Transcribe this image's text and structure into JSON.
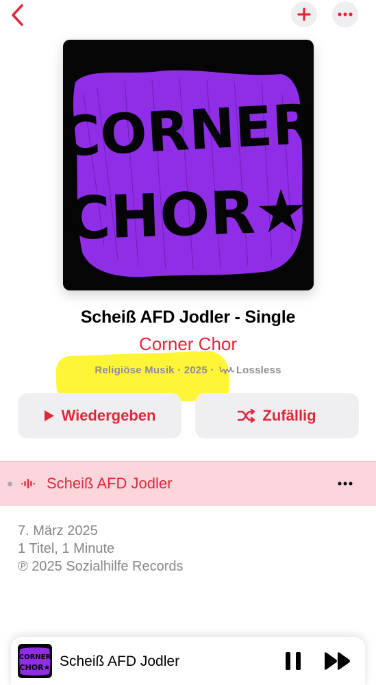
{
  "nav": {
    "back_icon": "chevron-left-icon",
    "add_icon": "plus-icon",
    "more_icon": "ellipsis-icon",
    "accent": "#e0273a"
  },
  "artwork": {
    "lettering": [
      "CORNER",
      "CHOR★"
    ],
    "background": "#050505",
    "color": "#8f2ee6"
  },
  "album": {
    "title": "Scheiß AFD Jodler - Single",
    "artist": "Corner Chor",
    "genre": "Religiöse Musik",
    "separator": "·",
    "year": "2025",
    "quality": "Lossless",
    "quality_icon": "lossless-icon"
  },
  "highlight_color": "#fff200",
  "actions": {
    "play_label": "Wiedergeben",
    "play_icon": "play-icon",
    "shuffle_label": "Zufällig",
    "shuffle_icon": "shuffle-icon"
  },
  "tracks": [
    {
      "title": "Scheiß AFD Jodler",
      "playing": true,
      "state_icon": "now-playing-waveform-icon"
    }
  ],
  "info": {
    "release_date": "7. März 2025",
    "summary": "1 Titel, 1 Minute",
    "copyright": "℗ 2025 Sozialhilfe Records"
  },
  "mini_player": {
    "title": "Scheiß AFD Jodler",
    "pause_icon": "pause-icon",
    "forward_icon": "forward-icon"
  }
}
